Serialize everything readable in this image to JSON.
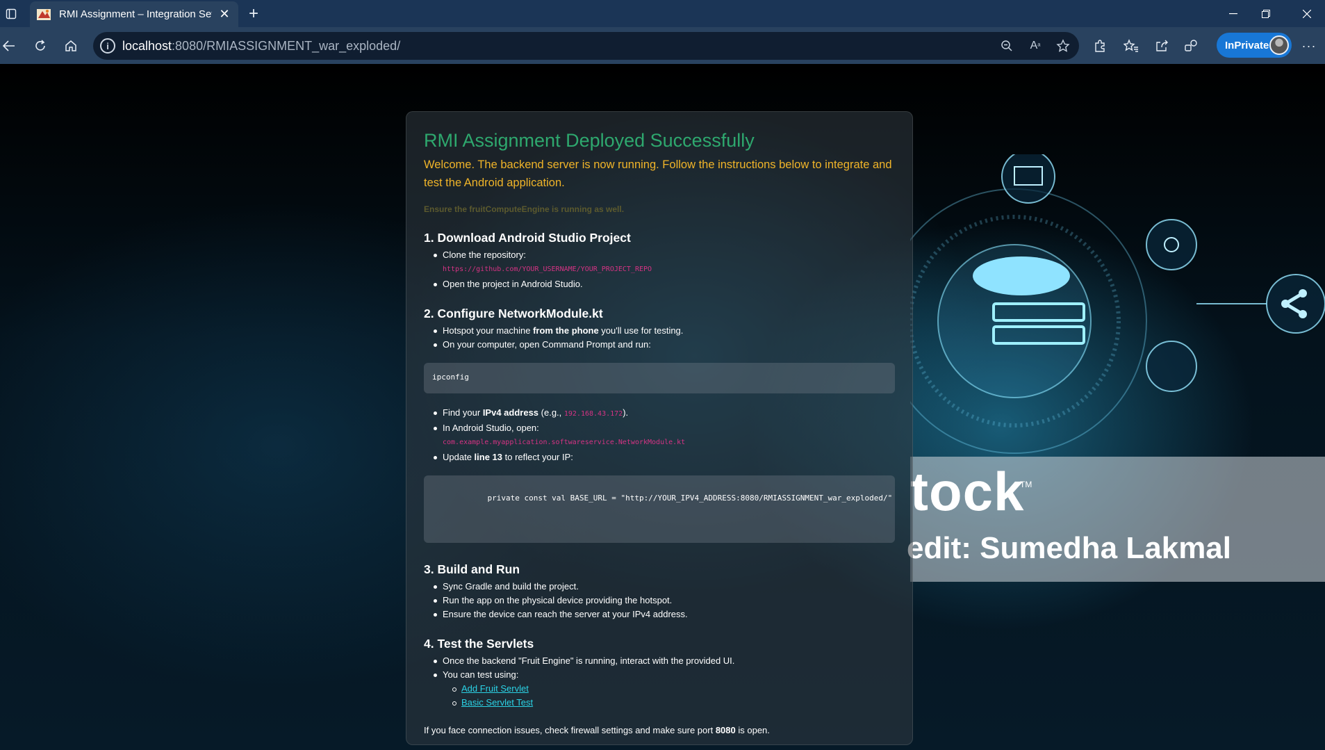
{
  "browser": {
    "tab_title": "RMI Assignment – Integration Set",
    "url_host": "localhost",
    "url_path": ":8080/RMIASSIGNMENT_war_exploded/",
    "inprivate_label": "InPrivate"
  },
  "background": {
    "watermark_line1": "tock",
    "watermark_line2": "edit: Sumedha Lakmal",
    "watermark_tm": "TM"
  },
  "card": {
    "title": "RMI Assignment Deployed Successfully",
    "welcome": "Welcome. The backend server is now running. Follow the instructions below to integrate and test the Android application.",
    "note": "Ensure the fruitComputeEngine is running as well.",
    "s1": {
      "heading": "1. Download Android Studio Project",
      "clone": "Clone the repository:",
      "repo_url": "https://github.com/YOUR_USERNAME/YOUR_PROJECT_REPO",
      "open": "Open the project in Android Studio."
    },
    "s2": {
      "heading": "2. Configure NetworkModule.kt",
      "hotspot_a": "Hotspot your machine ",
      "hotspot_b": "from the phone",
      "hotspot_c": " you'll use for testing.",
      "cmd": "On your computer, open Command Prompt and run:",
      "ipconfig": "ipconfig",
      "find_a": "Find your ",
      "find_b": "IPv4 address",
      "find_c": " (e.g., ",
      "find_ip": "192.168.43.172",
      "find_d": ").",
      "open_in": "In Android Studio, open:",
      "module_path": "com.example.myapplication.softwareservice.NetworkModule.kt",
      "update_a": "Update ",
      "update_b": "line 13",
      "update_c": " to reflect your IP:",
      "code_line": "            private const val BASE_URL = \"http://YOUR_IPV4_ADDRESS:8080/RMIASSIGNMENT_war_exploded/\""
    },
    "s3": {
      "heading": "3. Build and Run",
      "items": [
        "Sync Gradle and build the project.",
        "Run the app on the physical device providing the hotspot.",
        "Ensure the device can reach the server at your IPv4 address."
      ]
    },
    "s4": {
      "heading": "4. Test the Servlets",
      "once": "Once the backend \"Fruit Engine\" is running, interact with the provided UI.",
      "using": "You can test using:",
      "link1": "Add Fruit Servlet",
      "link2": "Basic Servlet Test"
    },
    "footer_a": "If you face connection issues, check firewall settings and make sure port ",
    "footer_b": "8080",
    "footer_c": " is open."
  },
  "colors": {
    "title_green": "#2ea86e",
    "welcome_orange": "#f0b429",
    "code_pink": "#d63384",
    "link_cyan": "#2bd3e6",
    "chrome_blue": "#29425f"
  }
}
